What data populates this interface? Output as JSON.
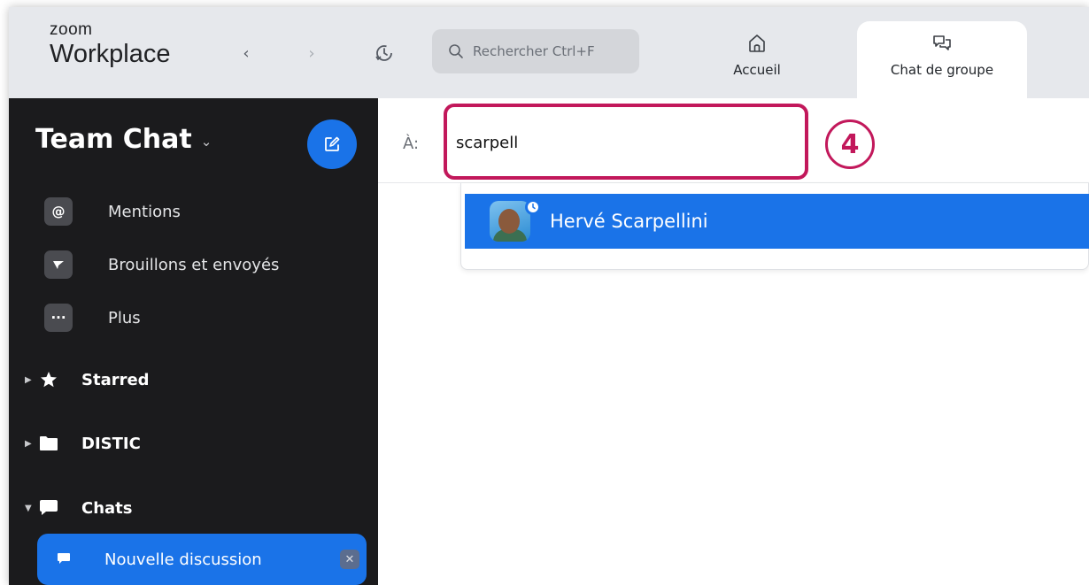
{
  "app": {
    "brand_small": "zoom",
    "brand_big": "Workplace"
  },
  "toolbar": {
    "back_symbol": "‹",
    "forward_symbol": "›",
    "search_placeholder": "Rechercher Ctrl+F"
  },
  "tabs": [
    {
      "label": "Accueil",
      "icon": "home-icon"
    },
    {
      "label": "Chat de groupe",
      "icon": "chat-bubbles-icon"
    }
  ],
  "sidebar": {
    "title": "Team Chat",
    "title_chevron": "⌄",
    "items": [
      {
        "label": "Mentions",
        "icon": "at-icon",
        "glyph": "@"
      },
      {
        "label": "Brouillons et envoyés",
        "icon": "send-icon",
        "glyph": ""
      },
      {
        "label": "Plus",
        "icon": "more-icon",
        "glyph": "···"
      }
    ],
    "groups": [
      {
        "label": "Starred",
        "icon": "star-icon",
        "expanded": false
      },
      {
        "label": "DISTIC",
        "icon": "folder-icon",
        "expanded": false
      },
      {
        "label": "Chats",
        "icon": "chat-icon",
        "expanded": true
      }
    ],
    "active_item": {
      "label": "Nouvelle discussion",
      "close_symbol": "✕"
    }
  },
  "compose": {
    "to_label": "À:",
    "to_value": "scarpell",
    "step_number": "4",
    "suggestion_name": "Hervé Scarpellini"
  },
  "colors": {
    "accent": "#1a73e8",
    "highlight": "#c2185b",
    "sidebar_bg": "#1b1b1d",
    "topbar_bg": "#e6e8ec"
  }
}
